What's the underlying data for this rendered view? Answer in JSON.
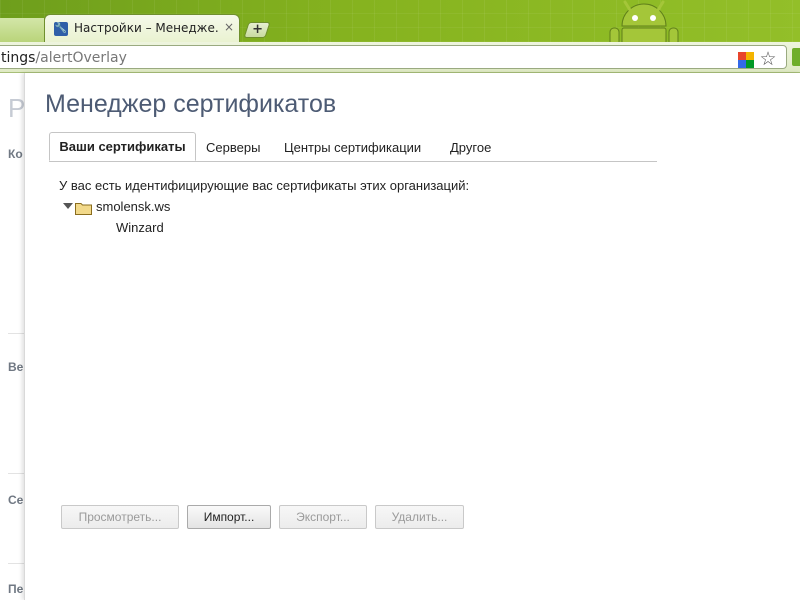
{
  "browser": {
    "tab_title": "Настройки – Менедже...",
    "tab_close": "×",
    "new_tab": "+",
    "url_prefix": "tings",
    "url_path": "/alertOverlay",
    "star": "☆",
    "favicon": "🔧"
  },
  "background_page": {
    "title_letter": "Р",
    "section_labels": [
      "Ко",
      "Ве",
      "Се",
      "Пе"
    ]
  },
  "dialog": {
    "title": "Менеджер сертификатов",
    "tabs": [
      {
        "label": "Ваши сертификаты",
        "active": true
      },
      {
        "label": "Серверы",
        "active": false
      },
      {
        "label": "Центры сертификации",
        "active": false
      },
      {
        "label": "Другое",
        "active": false
      }
    ],
    "intro": "У вас есть идентифицирующие вас сертификаты этих организаций:",
    "tree": {
      "organization": "smolensk.ws",
      "expanded": true,
      "certificates": [
        "Winzard"
      ]
    },
    "buttons": [
      {
        "label": "Просмотреть...",
        "enabled": false
      },
      {
        "label": "Импорт...",
        "enabled": true
      },
      {
        "label": "Экспорт...",
        "enabled": false
      },
      {
        "label": "Удалить...",
        "enabled": false
      }
    ]
  },
  "colors": {
    "chrome_green": "#86b31f",
    "title_color": "#4d5b74",
    "folder_fill": "#f2d98a"
  }
}
